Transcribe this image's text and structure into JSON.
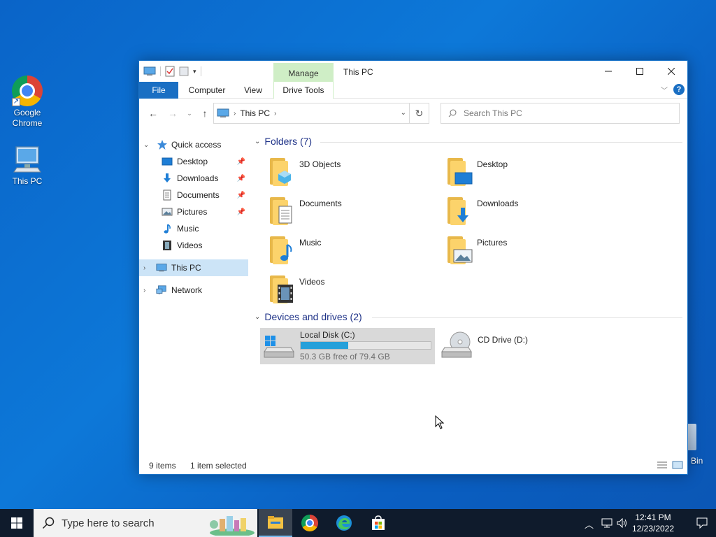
{
  "desktop": {
    "icons": [
      {
        "label_line1": "Google",
        "label_line2": "Chrome"
      },
      {
        "label_line1": "This PC"
      }
    ],
    "recycle_bin_label": "Bin"
  },
  "window": {
    "title": "This PC",
    "manage_tab": "Manage",
    "ribbon_tabs": [
      "File",
      "Computer",
      "View",
      "Drive Tools"
    ],
    "address": {
      "crumb": "This PC"
    },
    "search_placeholder": "Search This PC"
  },
  "nav": {
    "quick_access": "Quick access",
    "quick_items": [
      "Desktop",
      "Downloads",
      "Documents",
      "Pictures",
      "Music",
      "Videos"
    ],
    "this_pc": "This PC",
    "network": "Network"
  },
  "content": {
    "folders_header": "Folders (7)",
    "folders": [
      "3D Objects",
      "Desktop",
      "Documents",
      "Downloads",
      "Music",
      "Pictures",
      "Videos"
    ],
    "devices_header": "Devices and drives (2)",
    "drives": [
      {
        "name": "Local Disk (C:)",
        "free_text": "50.3 GB free of 79.4 GB",
        "used_fraction": 0.366,
        "selected": true
      },
      {
        "name": "CD Drive (D:)"
      }
    ]
  },
  "status": {
    "items": "9 items",
    "selected": "1 item selected"
  },
  "taskbar": {
    "search_placeholder": "Type here to search",
    "time": "12:41 PM",
    "date": "12/23/2022"
  },
  "colors": {
    "accent": "#1a6fc3",
    "selection": "#cce4f7",
    "manage_tab": "#cfeec6",
    "drive_fill": "#26a0da"
  }
}
